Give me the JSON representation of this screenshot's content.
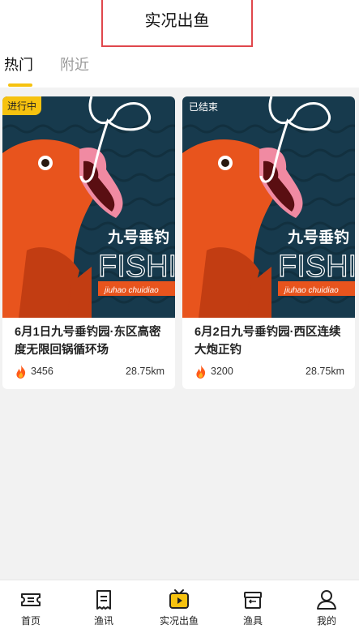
{
  "header": {
    "title": "实况出鱼"
  },
  "tabs": [
    {
      "label": "热门",
      "active": true
    },
    {
      "label": "附近",
      "active": false
    }
  ],
  "cards": [
    {
      "status": "进行中",
      "poster_brand": "九号垂钓",
      "poster_word": "FISHING",
      "poster_sub": "jiuhao chuidiao",
      "title": "6月1日九号垂钓园·东区高密度无限回锅循环场",
      "heat": "3456",
      "distance": "28.75km"
    },
    {
      "status": "已结束",
      "poster_brand": "九号垂钓",
      "poster_word": "FISHING",
      "poster_sub": "jiuhao chuidiao",
      "title": "6月2日九号垂钓园·西区连续大炮正钓",
      "heat": "3200",
      "distance": "28.75km"
    }
  ],
  "bottom_nav": [
    {
      "label": "首页",
      "icon": "ticket-icon"
    },
    {
      "label": "渔讯",
      "icon": "receipt-icon"
    },
    {
      "label": "实况出鱼",
      "icon": "tv-play-icon",
      "active": true
    },
    {
      "label": "渔具",
      "icon": "box-icon"
    },
    {
      "label": "我的",
      "icon": "user-icon"
    }
  ],
  "colors": {
    "accent": "#f6c20f",
    "fish": "#e8541d",
    "poster_bg": "#173a4d"
  }
}
